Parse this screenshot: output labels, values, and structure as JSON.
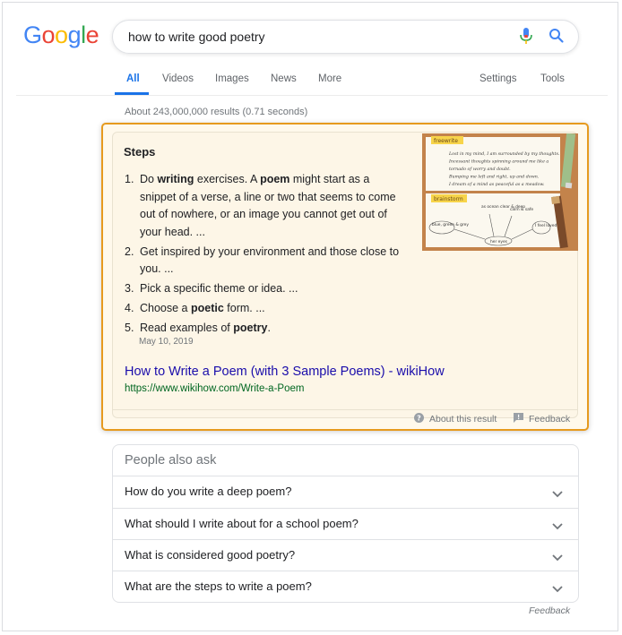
{
  "logo": [
    "G",
    "o",
    "o",
    "g",
    "l",
    "e"
  ],
  "logo_colors": [
    "#4285f4",
    "#ea4335",
    "#fbbc05",
    "#4285f4",
    "#34a853",
    "#ea4335"
  ],
  "search": {
    "query": "how to write good poetry",
    "mic_icon": "mic-icon",
    "search_icon": "search-icon"
  },
  "tabs": {
    "all": "All",
    "videos": "Videos",
    "images": "Images",
    "news": "News",
    "more": "More",
    "settings": "Settings",
    "tools": "Tools"
  },
  "result_stats": "About 243,000,000 results (0.71 seconds)",
  "snippet": {
    "title": "Steps",
    "steps": [
      {
        "num": "1.",
        "parts": [
          "Do ",
          "writing",
          " exercises. A ",
          "poem",
          " might start as a snippet of a verse, a line or two that seems to come out of nowhere, or an image you cannot get out of your head. ..."
        ]
      },
      {
        "num": "2.",
        "parts": [
          "Get inspired by your environment and those close to you. ..."
        ]
      },
      {
        "num": "3.",
        "parts": [
          "Pick a specific theme or idea. ..."
        ]
      },
      {
        "num": "4.",
        "parts": [
          "Choose a ",
          "poetic",
          " form. ..."
        ]
      },
      {
        "num": "5.",
        "parts": [
          "Read examples of ",
          "poetry",
          "."
        ]
      }
    ],
    "date": "May 10, 2019",
    "link": "How to Write a Poem (with 3 Sample Poems) - wikiHow",
    "url": "https://www.wikihow.com/Write-a-Poem",
    "about": "About this result",
    "feedback": "Feedback",
    "thumb": {
      "label_top": "freewrite",
      "label_bottom": "brainstorm",
      "lines": [
        "Lost in my mind, I am surrounded by my thoughts.",
        "Incessant thoughts spinning around me like a",
        "tornado of worry and doubt.",
        "Bumping me left and right, up and down.",
        "I dream of a mind as peaceful as a meadow."
      ],
      "bubbles": [
        "blue, green & grey",
        "as ocean clear & deep",
        "calm & safe",
        "her eyes",
        "I feel loved"
      ]
    }
  },
  "paa": {
    "title": "People also ask",
    "questions": [
      "How do you write a deep poem?",
      "What should I write about for a school poem?",
      "What is considered good poetry?",
      "What are the steps to write a poem?"
    ]
  },
  "feedback_bottom": "Feedback"
}
